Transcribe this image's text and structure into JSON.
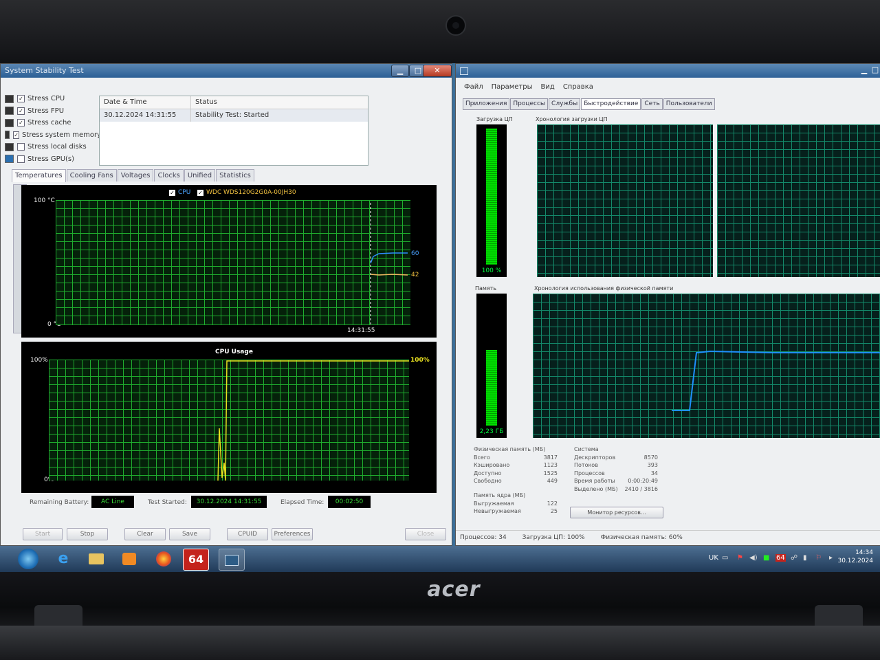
{
  "stability": {
    "title": "System Stability Test",
    "stress_items": [
      {
        "label": "Stress CPU",
        "checked": true
      },
      {
        "label": "Stress FPU",
        "checked": true
      },
      {
        "label": "Stress cache",
        "checked": true
      },
      {
        "label": "Stress system memory",
        "checked": true
      },
      {
        "label": "Stress local disks",
        "checked": false
      },
      {
        "label": "Stress GPU(s)",
        "checked": false
      }
    ],
    "log": {
      "headers": [
        "Date & Time",
        "Status"
      ],
      "rows": [
        [
          "30.12.2024 14:31:55",
          "Stability Test: Started"
        ]
      ]
    },
    "tabs": [
      "Temperatures",
      "Cooling Fans",
      "Voltages",
      "Clocks",
      "Unified",
      "Statistics"
    ],
    "temp_graph": {
      "legend": [
        "CPU",
        "WDC WDS120G2G0A-00JH30"
      ],
      "ymax_label": "100 °C",
      "ymin_label": "0 °C",
      "time_label": "14:31:55",
      "cpu_value": "60",
      "disk_value": "42"
    },
    "cpu_graph": {
      "title": "CPU Usage",
      "ymax_label": "100%",
      "ymin_label": "0%",
      "value_label": "100%"
    },
    "status": {
      "battery_label": "Remaining Battery:",
      "battery_value": "AC Line",
      "started_label": "Test Started:",
      "started_value": "30.12.2024 14:31:55",
      "elapsed_label": "Elapsed Time:",
      "elapsed_value": "00:02:50"
    },
    "buttons": {
      "start": "Start",
      "stop": "Stop",
      "clear": "Clear",
      "save": "Save",
      "cpuid": "CPUID",
      "preferences": "Preferences",
      "close": "Close"
    }
  },
  "taskmgr": {
    "menu": [
      "Файл",
      "Параметры",
      "Вид",
      "Справка"
    ],
    "tabs": [
      "Приложения",
      "Процессы",
      "Службы",
      "Быстродействие",
      "Сеть",
      "Пользователи"
    ],
    "cpu_label": "Загрузка ЦП",
    "cpu_value": "100 %",
    "cpu_history_label": "Хронология загрузки ЦП",
    "mem_label": "Память",
    "mem_value": "2,23 ГБ",
    "mem_history_label": "Хронология использования физической памяти",
    "phys_mem": {
      "title": "Физическая память (МБ)",
      "rows": [
        [
          "Всего",
          "3817"
        ],
        [
          "Кэшировано",
          "1123"
        ],
        [
          "Доступно",
          "1525"
        ],
        [
          "Свободно",
          "449"
        ]
      ]
    },
    "kernel_mem": {
      "title": "Память ядра (МБ)",
      "rows": [
        [
          "Выгружаемая",
          "122"
        ],
        [
          "Невыгружаемая",
          "25"
        ]
      ]
    },
    "system": {
      "title": "Система",
      "rows": [
        [
          "Дескрипторов",
          "8570"
        ],
        [
          "Потоков",
          "393"
        ],
        [
          "Процессов",
          "34"
        ],
        [
          "Время работы",
          "0:00:20:49"
        ],
        [
          "Выделено (МБ)",
          "2410 / 3816"
        ]
      ]
    },
    "resource_button": "Монитор ресурсов...",
    "statusbar": [
      "Процессов: 34",
      "Загрузка ЦП: 100%",
      "Физическая память: 60%"
    ]
  },
  "taskbar": {
    "items": [
      "ie-icon",
      "explorer-icon",
      "media-player-icon",
      "firefox-icon",
      "aida64-icon",
      "task-manager-icon"
    ],
    "aida_label": "64",
    "lang": "UK",
    "time": "14:34",
    "date": "30.12.2024"
  },
  "brand": "acer"
}
